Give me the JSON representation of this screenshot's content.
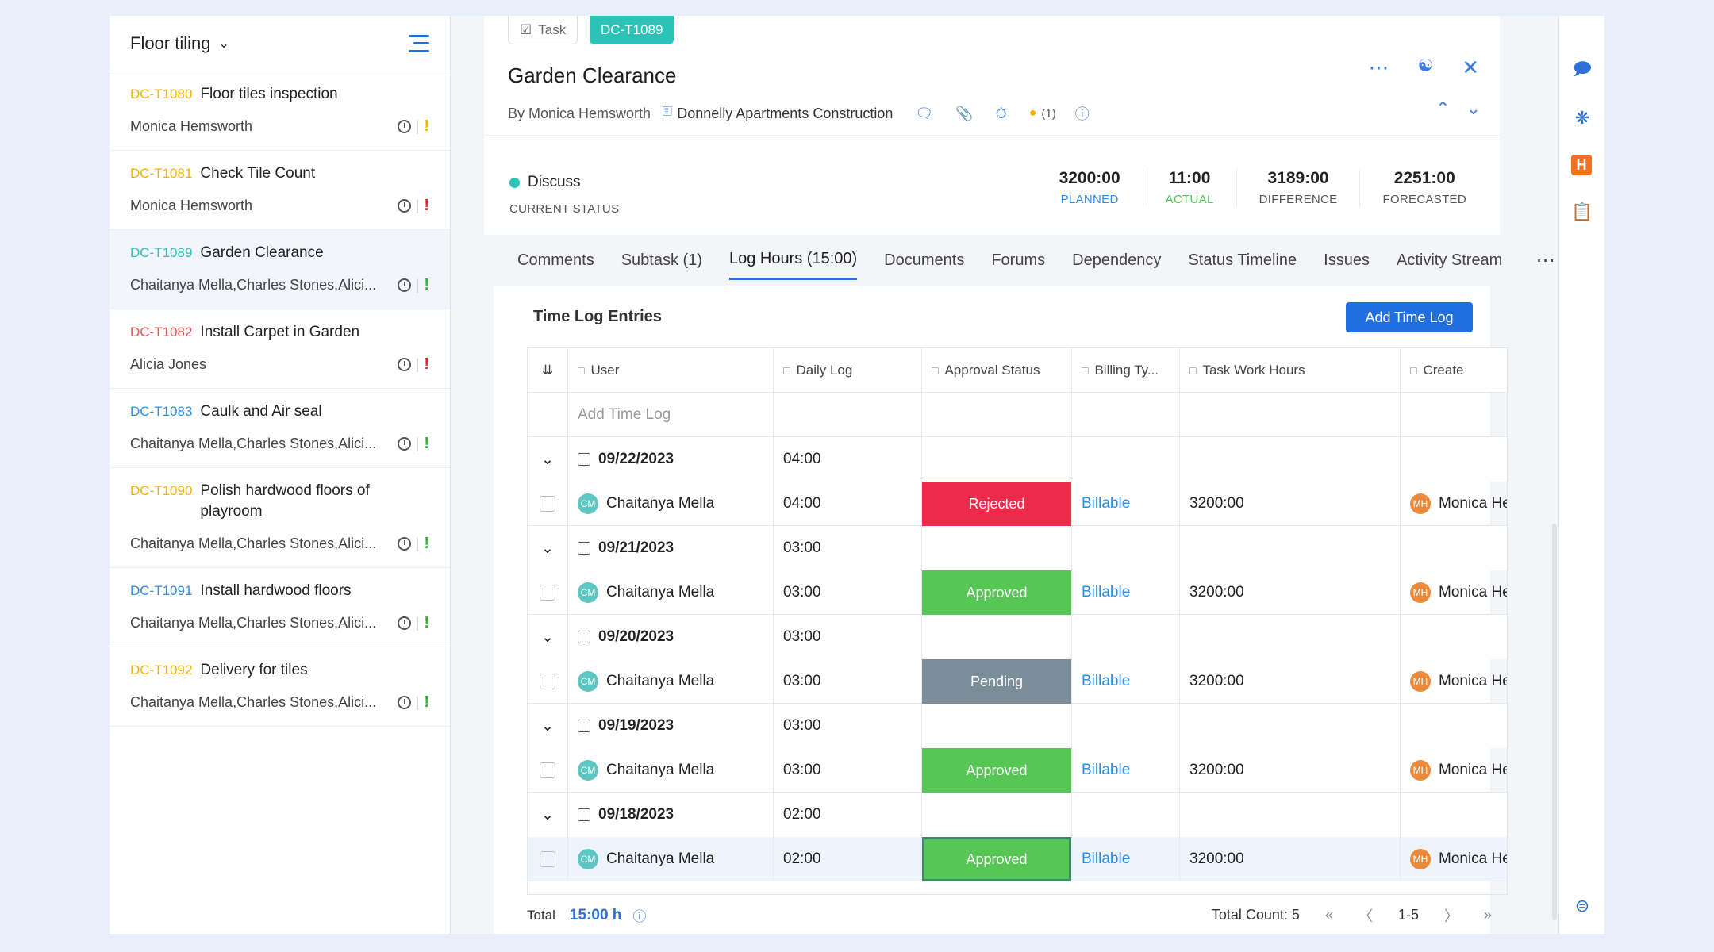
{
  "left": {
    "title": "Floor tiling",
    "tasks": [
      {
        "id": "DC-T1080",
        "id_color": "#f5b400",
        "name": "Floor tiles inspection",
        "name2": "",
        "people": "Monica Hemsworth",
        "bang_color": "#f5b400"
      },
      {
        "id": "DC-T1081",
        "id_color": "#f5b400",
        "name": "Check Tile Count",
        "name2": "",
        "people": "Monica Hemsworth",
        "bang_color": "#e8212e"
      },
      {
        "id": "DC-T1089",
        "id_color": "#2ac3b6",
        "name": "Garden Clearance",
        "name2": "",
        "people": "Chaitanya Mella,Charles Stones,Alici...",
        "bang_color": "#2fb52f"
      },
      {
        "id": "DC-T1082",
        "id_color": "#ef5350",
        "name": "Install Carpet in Garden",
        "name2": "",
        "people": "Alicia Jones",
        "bang_color": "#e8212e"
      },
      {
        "id": "DC-T1083",
        "id_color": "#2c8de6",
        "name": "Caulk and Air seal",
        "name2": "",
        "people": "Chaitanya Mella,Charles Stones,Alici...",
        "bang_color": "#2fb52f"
      },
      {
        "id": "DC-T1090",
        "id_color": "#f5b400",
        "name": "Polish hardwood floors of",
        "name2": "playroom",
        "people": "Chaitanya Mella,Charles Stones,Alici...",
        "bang_color": "#2fb52f"
      },
      {
        "id": "DC-T1091",
        "id_color": "#2c8de6",
        "name": "Install hardwood floors",
        "name2": "",
        "people": "Chaitanya Mella,Charles Stones,Alici...",
        "bang_color": "#2fb52f"
      },
      {
        "id": "DC-T1092",
        "id_color": "#f5b400",
        "name": "Delivery for tiles",
        "name2": "",
        "people": "Chaitanya Mella,Charles Stones,Alici...",
        "bang_color": "#2fb52f"
      }
    ]
  },
  "header": {
    "chip_task": "Task",
    "chip_id": "DC-T1089",
    "title": "Garden Clearance",
    "by": "By Monica Hemsworth",
    "project": "Donnelly Apartments Construction",
    "count": "(1)"
  },
  "status": {
    "current": "Discuss",
    "current_label": "CURRENT STATUS",
    "stats": [
      {
        "value": "3200:00",
        "label": "PLANNED",
        "color": "#2c8de6"
      },
      {
        "value": "11:00",
        "label": "ACTUAL",
        "color": "#56c654"
      },
      {
        "value": "3189:00",
        "label": "DIFFERENCE",
        "color": "#555555"
      },
      {
        "value": "2251:00",
        "label": "FORECASTED",
        "color": "#555555"
      }
    ]
  },
  "tabs": [
    "Comments",
    "Subtask (1)",
    "Log Hours (15:00)",
    "Documents",
    "Forums",
    "Dependency",
    "Status Timeline",
    "Issues",
    "Activity Stream"
  ],
  "log": {
    "title": "Time Log Entries",
    "add_button": "Add Time Log",
    "columns": [
      "User",
      "Daily Log",
      "Approval Status",
      "Billing Ty...",
      "Task Work Hours",
      "Create"
    ],
    "add_placeholder": "Add Time Log",
    "groups": [
      {
        "date": "09/22/2023",
        "daily": "04:00",
        "user": "Chaitanya Mella",
        "log": "04:00",
        "status": "Rejected",
        "billing": "Billable",
        "hours": "3200:00",
        "creator": "Monica He"
      },
      {
        "date": "09/21/2023",
        "daily": "03:00",
        "user": "Chaitanya Mella",
        "log": "03:00",
        "status": "Approved",
        "billing": "Billable",
        "hours": "3200:00",
        "creator": "Monica He"
      },
      {
        "date": "09/20/2023",
        "daily": "03:00",
        "user": "Chaitanya Mella",
        "log": "03:00",
        "status": "Pending",
        "billing": "Billable",
        "hours": "3200:00",
        "creator": "Monica He"
      },
      {
        "date": "09/19/2023",
        "daily": "03:00",
        "user": "Chaitanya Mella",
        "log": "03:00",
        "status": "Approved",
        "billing": "Billable",
        "hours": "3200:00",
        "creator": "Monica He"
      },
      {
        "date": "09/18/2023",
        "daily": "02:00",
        "user": "Chaitanya Mella",
        "log": "02:00",
        "status": "Approved",
        "billing": "Billable",
        "hours": "3200:00",
        "creator": "Monica He"
      }
    ],
    "cm": "CM",
    "mh": "MH"
  },
  "footer": {
    "total_label": "Total",
    "total_value": "15:00 h",
    "count": "Total Count: 5",
    "range": "1-5"
  }
}
